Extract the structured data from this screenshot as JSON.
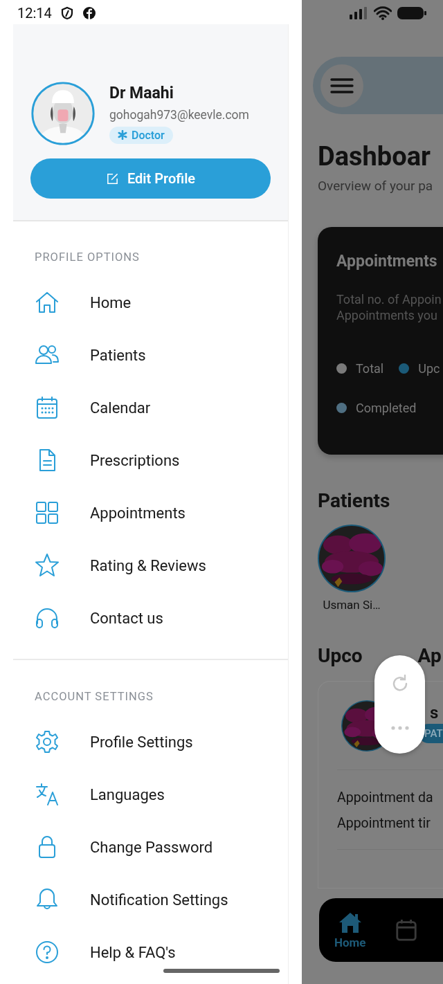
{
  "status_bar": {
    "time": "12:14"
  },
  "drawer": {
    "profile": {
      "name": "Dr Maahi",
      "email": "gohogah973@keevle.com",
      "role": "Doctor",
      "edit_button": "Edit Profile"
    },
    "sections": [
      {
        "title": "PROFILE OPTIONS",
        "items": [
          {
            "label": "Home",
            "kind": "home"
          },
          {
            "label": "Patients",
            "kind": "users"
          },
          {
            "label": "Calendar",
            "kind": "calendar"
          },
          {
            "label": "Prescriptions",
            "kind": "document"
          },
          {
            "label": "Appointments",
            "kind": "grid"
          },
          {
            "label": "Rating & Reviews",
            "kind": "star"
          },
          {
            "label": "Contact us",
            "kind": "headset"
          }
        ]
      },
      {
        "title": "ACCOUNT SETTINGS",
        "items": [
          {
            "label": "Profile Settings",
            "kind": "gear"
          },
          {
            "label": "Languages",
            "kind": "translate"
          },
          {
            "label": "Change Password",
            "kind": "lock"
          },
          {
            "label": "Notification Settings",
            "kind": "bell"
          },
          {
            "label": "Help & FAQ's",
            "kind": "help"
          }
        ]
      }
    ]
  },
  "dashboard": {
    "title": "Dashboar",
    "subtitle": "Overview of your pa",
    "appointments_card": {
      "title": "Appointments",
      "description": [
        "Total no. of Appoin",
        "Appointments you"
      ],
      "legend": [
        {
          "label": "Total",
          "color": "#7a7a7a"
        },
        {
          "label": "Upc",
          "color": "#1b5a78"
        },
        {
          "label": "Completed",
          "color": "#4f6f82"
        }
      ]
    },
    "patients": {
      "title": "Patients",
      "items": [
        {
          "name": "Usman Si…"
        }
      ]
    },
    "upcoming": {
      "title_start": "Upco",
      "title_end": "Ap",
      "card": {
        "name": "s",
        "badge": "PAT",
        "lines": [
          "Appointment da",
          "Appointment tir"
        ]
      }
    },
    "bottom_nav": [
      {
        "label": "Home",
        "kind": "home",
        "selected": true
      },
      {
        "kind": "calendar",
        "selected": false
      }
    ]
  }
}
